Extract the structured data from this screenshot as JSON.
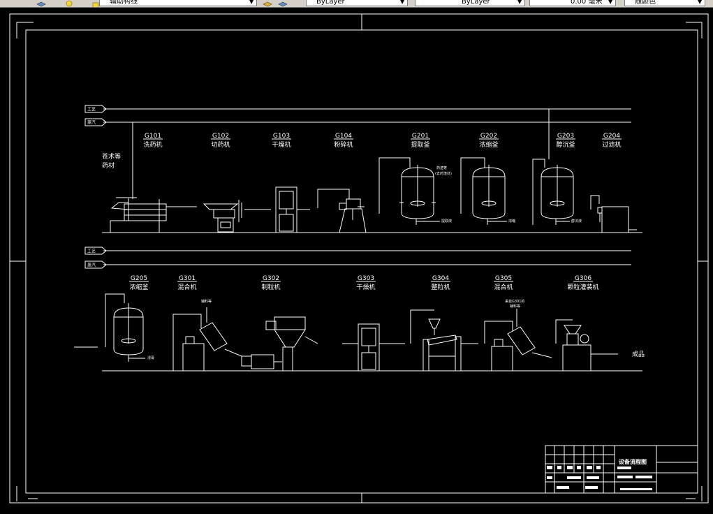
{
  "toolbar": {
    "layer_name": "辅助构线",
    "color": "ByLayer",
    "linetype": "ByLayer",
    "lineweight": "0.00 毫米",
    "plotstyle": "随颜色"
  },
  "drawing": {
    "pipes_top": [
      "工艺",
      "蒸汽"
    ],
    "pipes_bottom": [
      "工艺",
      "蒸汽"
    ],
    "raw_material": [
      "苍术等",
      "药材"
    ],
    "product": "成品",
    "equipment_row1": [
      {
        "code": "G101",
        "name": "洗药机"
      },
      {
        "code": "G102",
        "name": "切药机"
      },
      {
        "code": "G103",
        "name": "干燥机"
      },
      {
        "code": "G104",
        "name": "粉碎机"
      },
      {
        "code": "G201",
        "name": "提取釜"
      },
      {
        "code": "G202",
        "name": "浓缩釜"
      },
      {
        "code": "G203",
        "name": "醇沉釜"
      },
      {
        "code": "G204",
        "name": "过滤机"
      }
    ],
    "equipment_row2": [
      {
        "code": "G205",
        "name": "浓缩釜"
      },
      {
        "code": "G301",
        "name": "混合机"
      },
      {
        "code": "G302",
        "name": "制粒机"
      },
      {
        "code": "G303",
        "name": "干燥机"
      },
      {
        "code": "G304",
        "name": "整粒机"
      },
      {
        "code": "G305",
        "name": "混合机"
      },
      {
        "code": "G306",
        "name": "颗粒灌装机"
      }
    ],
    "small_labels": {
      "g201_note1": "药渣等",
      "g201_note2": "(去药渣处)",
      "g201_out": "提取液",
      "g202_out": "浓缩",
      "g203_out": "醇沉液",
      "g205_out": "浸膏",
      "g301_in": "辅料等",
      "g305_in1": "来自G301的",
      "g305_in2": "辅料等"
    },
    "title_block": {
      "title": "设备流程图"
    }
  }
}
